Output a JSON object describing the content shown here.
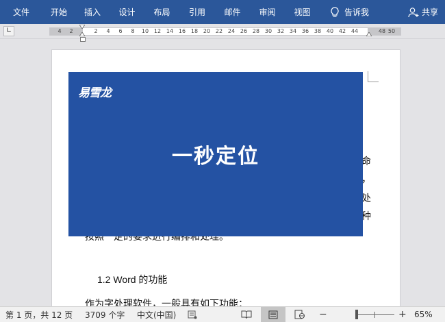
{
  "ribbon": {
    "tabs": [
      "文件",
      "开始",
      "插入",
      "设计",
      "布局",
      "引用",
      "邮件",
      "审阅",
      "视图"
    ],
    "tell_me": "告诉我",
    "share": "共享"
  },
  "ruler": {
    "corner_symbol": "∟",
    "left_numbers": [
      "4",
      "2"
    ],
    "main_numbers": [
      "2",
      "4",
      "6",
      "8",
      "10",
      "12",
      "14",
      "16",
      "18",
      "20",
      "22",
      "24",
      "26",
      "28",
      "30",
      "32",
      "34",
      "36",
      "38",
      "40",
      "42",
      "44"
    ],
    "right_numbers": [
      "48",
      "50"
    ]
  },
  "overlay": {
    "logo": "易雪龙",
    "title": "一秒定位",
    "color": "#2452a3"
  },
  "document": {
    "heading": "1.2 Word 的功能",
    "paragraph": "作为字处理软件，一般具有如下功能：",
    "partial_line": "按照一定的要求进行编排和处理。",
    "edge_glyphs": [
      "命",
      "，",
      "处",
      "种"
    ]
  },
  "status": {
    "page": "第 1 页，共 12 页",
    "words": "3709 个字",
    "language": "中文(中国)",
    "zoom_minus": "−",
    "zoom_plus": "+",
    "zoom": "65%",
    "zoom_fraction": 0.2
  },
  "colors": {
    "ribbon": "#2b579a",
    "overlay": "#2452a3"
  }
}
